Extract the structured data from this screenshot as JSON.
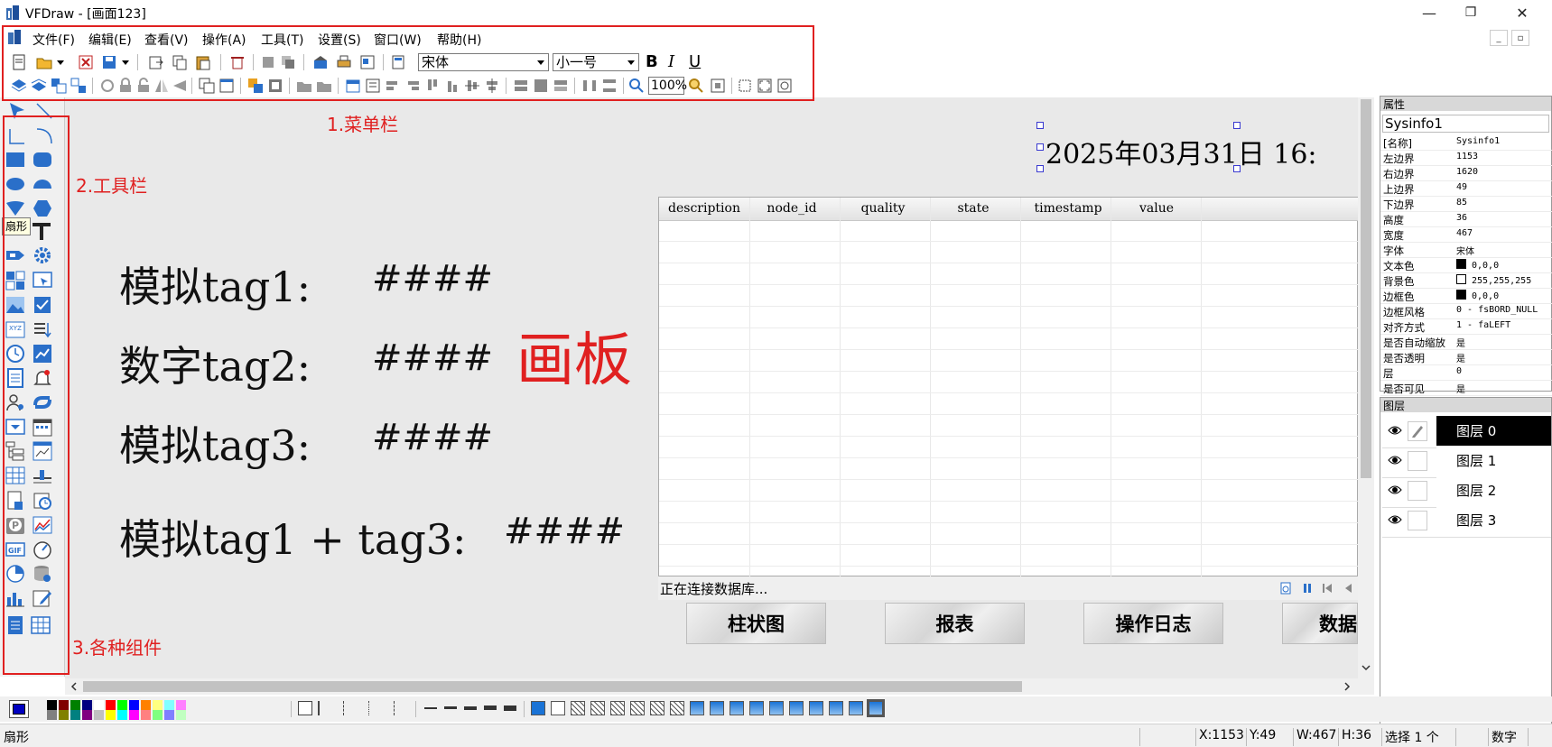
{
  "window": {
    "title": "VFDraw - [画面123]",
    "minimize_glyph": "—",
    "restore_glyph": "❐",
    "close_glyph": "✕"
  },
  "menu": [
    "文件(F)",
    "编辑(E)",
    "查看(V)",
    "操作(A)",
    "工具(T)",
    "设置(S)",
    "窗口(W)",
    "帮助(H)"
  ],
  "toolbar": {
    "font_name": "宋体",
    "font_size": "小一号",
    "bold": "B",
    "italic": "I",
    "underline": "U",
    "zoom": "100%"
  },
  "annotations": {
    "menubar": "1.菜单栏",
    "toolbar": "2.工具栏",
    "components": "3.各种组件",
    "canvas": "画板"
  },
  "palette": {
    "tooltip": "扇形"
  },
  "canvas": {
    "labels": [
      {
        "text": "模拟tag1:",
        "value": "####"
      },
      {
        "text": "数字tag2:",
        "value": "####"
      },
      {
        "text": "模拟tag3:",
        "value": "####"
      },
      {
        "text": "模拟tag1 + tag3:",
        "value": "####"
      }
    ],
    "datetime": "2025年03月31日 16:",
    "table": {
      "columns": [
        "description",
        "node_id",
        "quality",
        "state",
        "timestamp",
        "value"
      ],
      "status": "正在连接数据库..."
    },
    "buttons": [
      "柱状图",
      "报表",
      "操作日志",
      "数据"
    ]
  },
  "properties": {
    "title": "属性",
    "object_name": "Sysinfo1",
    "rows": [
      {
        "key": "[名称]",
        "value": "Sysinfo1"
      },
      {
        "key": "左边界",
        "value": "1153"
      },
      {
        "key": "右边界",
        "value": "1620"
      },
      {
        "key": "上边界",
        "value": "49"
      },
      {
        "key": "下边界",
        "value": "85"
      },
      {
        "key": "高度",
        "value": "36"
      },
      {
        "key": "宽度",
        "value": "467"
      },
      {
        "key": "字体",
        "value": "宋体"
      },
      {
        "key": "文本色",
        "value": "0,0,0",
        "swatch": "#000000"
      },
      {
        "key": "背景色",
        "value": "255,255,255",
        "swatch": "#ffffff"
      },
      {
        "key": "边框色",
        "value": "0,0,0",
        "swatch": "#000000"
      },
      {
        "key": "边框风格",
        "value": "0 - fsBORD_NULL"
      },
      {
        "key": "对齐方式",
        "value": "1 - faLEFT"
      },
      {
        "key": "是否自动缩放",
        "value": "是"
      },
      {
        "key": "是否透明",
        "value": "是"
      },
      {
        "key": "层",
        "value": "0"
      },
      {
        "key": "是否可见",
        "value": "是"
      }
    ]
  },
  "layers": {
    "title": "图层",
    "items": [
      {
        "name": "图层 0",
        "active": true
      },
      {
        "name": "图层 1",
        "active": false
      },
      {
        "name": "图层 2",
        "active": false
      },
      {
        "name": "图层 3",
        "active": false
      }
    ]
  },
  "status": {
    "hint": "扇形",
    "x": "X:1153",
    "y": "Y:49",
    "w": "W:467",
    "h": "H:36",
    "selection": "选择 1 个",
    "mode": "数字"
  },
  "colors": {
    "accent_red": "#e02020",
    "palette": [
      "#000000",
      "#808080",
      "#800000",
      "#808000",
      "#008000",
      "#008080",
      "#000080",
      "#800080",
      "#ffffff",
      "#c0c0c0",
      "#ff0000",
      "#ffff00",
      "#00ff00",
      "#00ffff",
      "#0000ff",
      "#ff00ff",
      "#ff8000",
      "#ff8080",
      "#ffff80",
      "#80ff80",
      "#80ffff",
      "#8080ff",
      "#ff80ff",
      "#c0ffc0"
    ]
  }
}
